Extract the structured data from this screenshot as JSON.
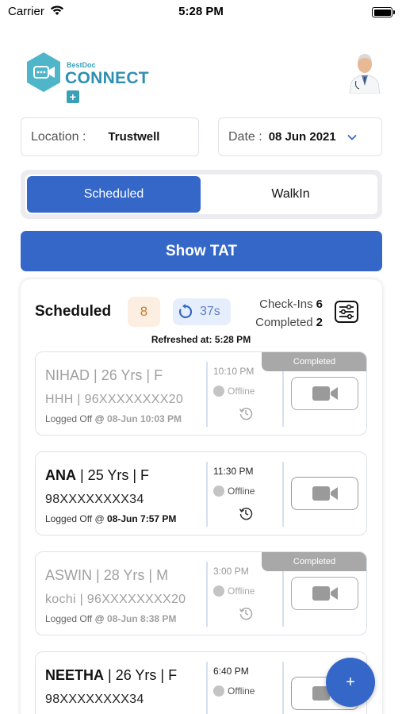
{
  "status_bar": {
    "carrier": "Carrier",
    "time": "5:28 PM"
  },
  "header": {
    "logo_small": "BestDoc",
    "logo_big": "CONNECT",
    "logo_plus": "+"
  },
  "filters": {
    "location_label": "Location :",
    "location_value": "Trustwell",
    "date_label": "Date :",
    "date_value": "08 Jun 2021"
  },
  "tabs": {
    "scheduled": "Scheduled",
    "walkin": "WalkIn"
  },
  "tat_button": "Show TAT",
  "summary": {
    "title": "Scheduled",
    "count": "8",
    "timer": "37s",
    "checkins_label": "Check-Ins",
    "checkins_value": "6",
    "completed_label": "Completed",
    "completed_value": "2",
    "refreshed": "Refreshed at: 5:28 PM"
  },
  "appointments": [
    {
      "name": "NIHAD",
      "age_sex": " | 26 Yrs | F",
      "phone": "HHH | 96XXXXXXXX20",
      "logged_prefix": "Logged Off @ ",
      "logged_time": "08-Jun 10:03 PM",
      "time": "10:10 PM",
      "status": "Offline",
      "tag": "Completed"
    },
    {
      "name": "ANA",
      "age_sex": " | 25 Yrs | F",
      "phone": "98XXXXXXXX34",
      "logged_prefix": "Logged Off @ ",
      "logged_time": "08-Jun 7:57 PM",
      "time": "11:30 PM",
      "status": "Offline",
      "tag": ""
    },
    {
      "name": "ASWIN",
      "age_sex": " | 28 Yrs | M",
      "phone": "kochi | 96XXXXXXXX20",
      "logged_prefix": "Logged Off @ ",
      "logged_time": "08-Jun 8:38 PM",
      "time": "3:00 PM",
      "status": "Offline",
      "tag": "Completed"
    },
    {
      "name": "NEETHA",
      "age_sex": " | 26 Yrs | F",
      "phone": "98XXXXXXXX34",
      "time": "6:40 PM",
      "status": "Offline",
      "tag": ""
    }
  ],
  "fab": "+",
  "colors": {
    "primary": "#3467c8",
    "badge_orange": "#c0802a",
    "tag_grey": "#a8a8a8"
  },
  "icons": [
    "wifi-icon",
    "battery-icon",
    "video-camera-icon",
    "history-icon",
    "refresh-icon",
    "filter-sliders-icon",
    "chevron-down-icon",
    "doctor-avatar"
  ]
}
